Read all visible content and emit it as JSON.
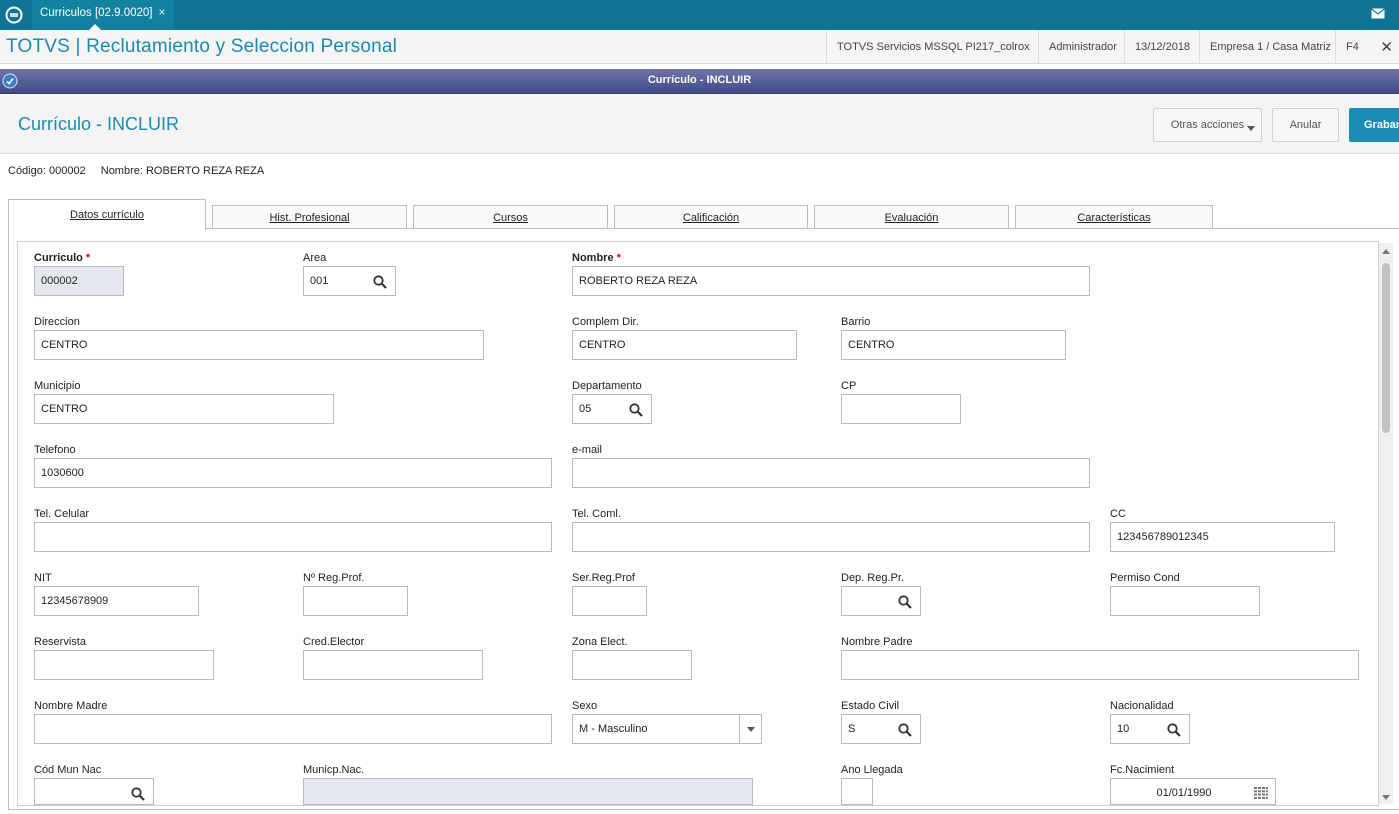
{
  "topbar": {
    "tab_label": "Curriculos [02.9.0020]",
    "tab_close": "×"
  },
  "header": {
    "app_title": "TOTVS | Reclutamiento y Seleccion Personal",
    "environment": "TOTVS Servicios MSSQL PI217_colrox",
    "user": "Administrador",
    "date": "13/12/2018",
    "company": "Empresa 1 / Casa Matriz",
    "shortcut": "F4",
    "close": "✕"
  },
  "window": {
    "title": "Currículo - INCLUIR"
  },
  "page": {
    "title": "Currículo - INCLUIR",
    "buttons": {
      "otras": "Otras acciones",
      "anular": "Anular",
      "grabar": "Grabar"
    },
    "record_code": "Código: 000002",
    "record_name": "Nombre: ROBERTO REZA REZA"
  },
  "tabs": [
    "Datos currículo",
    "Hist. Profesional",
    "Cursos",
    "Calificación",
    "Evaluación",
    "Características"
  ],
  "form": {
    "curriculo": {
      "label": "Curriculo",
      "value": "000002",
      "required": "*"
    },
    "area": {
      "label": "Area",
      "value": "001"
    },
    "nombre": {
      "label": "Nombre",
      "value": "ROBERTO REZA REZA",
      "required": "*"
    },
    "direccion": {
      "label": "Direccion",
      "value": "CENTRO"
    },
    "complem_dir": {
      "label": "Complem Dir.",
      "value": "CENTRO"
    },
    "barrio": {
      "label": "Barrio",
      "value": "CENTRO"
    },
    "municipio": {
      "label": "Municipio",
      "value": "CENTRO"
    },
    "departamento": {
      "label": "Departamento",
      "value": "05"
    },
    "cp": {
      "label": "CP",
      "value": ""
    },
    "telefono": {
      "label": "Telefono",
      "value": "1030600"
    },
    "email": {
      "label": "e-mail",
      "value": ""
    },
    "tel_celular": {
      "label": "Tel. Celular",
      "value": ""
    },
    "tel_coml": {
      "label": "Tel. Coml.",
      "value": ""
    },
    "cc": {
      "label": "CC",
      "value": "123456789012345"
    },
    "nit": {
      "label": "NIT",
      "value": "12345678909"
    },
    "no_reg_prof": {
      "label": "Nº Reg.Prof.",
      "value": ""
    },
    "ser_reg_prof": {
      "label": "Ser.Reg.Prof",
      "value": ""
    },
    "dep_reg_pr": {
      "label": "Dep. Reg.Pr.",
      "value": ""
    },
    "permiso_cond": {
      "label": "Permiso Cond",
      "value": ""
    },
    "reservista": {
      "label": "Reservista",
      "value": ""
    },
    "cred_elector": {
      "label": "Cred.Elector",
      "value": ""
    },
    "zona_elect": {
      "label": "Zona Elect.",
      "value": ""
    },
    "nombre_padre": {
      "label": "Nombre Padre",
      "value": ""
    },
    "nombre_madre": {
      "label": "Nombre Madre",
      "value": ""
    },
    "sexo": {
      "label": "Sexo",
      "value": "M - Masculino"
    },
    "estado_civil": {
      "label": "Estado Civil",
      "value": "S"
    },
    "nacionalidad": {
      "label": "Nacionalidad",
      "value": "10"
    },
    "cod_mun_nac": {
      "label": "Cód Mun Nac",
      "value": ""
    },
    "municp_nac": {
      "label": "Municp.Nac.",
      "value": ""
    },
    "ano_llegada": {
      "label": "Ano Llegada",
      "value": ""
    },
    "fc_nacimient": {
      "label": "Fc.Nacimient",
      "value": "01/01/1990"
    }
  },
  "colors": {
    "topbar": "#0f7494",
    "accent": "#1a8ab0",
    "primary_button": "#1c8cb7",
    "required": "#d0021b"
  }
}
